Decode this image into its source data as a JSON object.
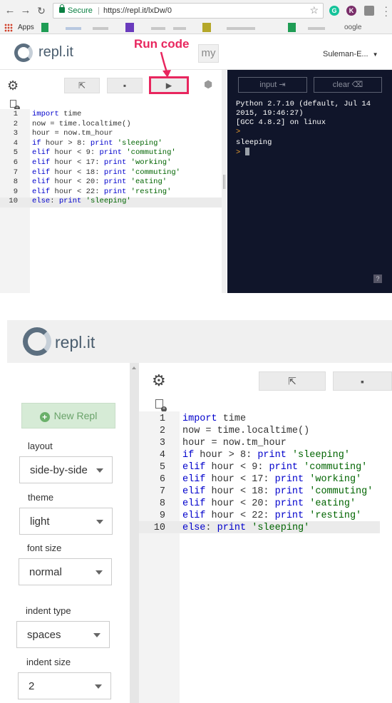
{
  "browser": {
    "secure_label": "Secure",
    "url": "https://repl.it/lxDw/0",
    "apps_label": "Apps",
    "bookmark_text": "oogle",
    "extensions": [
      {
        "icon": "grammarly-icon",
        "letter": "G",
        "color": "#15c39a"
      },
      {
        "icon": "profile-k-icon",
        "letter": "K",
        "color": "#7a2e6a"
      },
      {
        "icon": "screenshot-icon",
        "letter": "",
        "color": "#8a8a8a"
      }
    ]
  },
  "app": {
    "brand": "repl.it",
    "my_label": "my",
    "user_name": "Suleman-E...",
    "annotation": "Run code"
  },
  "editor": {
    "code_lines": [
      "import time",
      "now = time.localtime()",
      "hour = now.tm_hour",
      "if hour > 8: print 'sleeping'",
      "elif hour < 9: print 'commuting'",
      "elif hour < 17: print 'working'",
      "elif hour < 18: print 'commuting'",
      "elif hour < 20: print 'eating'",
      "elif hour < 22: print 'resting'",
      "else: print 'sleeping'"
    ],
    "line_numbers": [
      "1",
      "2",
      "3",
      "4",
      "5",
      "6",
      "7",
      "8",
      "9",
      "10"
    ],
    "active_line": "10"
  },
  "console": {
    "input_label": "input",
    "clear_label": "clear",
    "banner_lines": [
      "Python 2.7.10 (default, Jul 14",
      "2015, 19:46:27)",
      "[GCC 4.8.2] on linux"
    ],
    "prompt_symbol": ">",
    "output": "sleeping",
    "help_label": "?"
  },
  "sidebar": {
    "new_repl_label": "New Repl",
    "settings": [
      {
        "label": "layout",
        "value": "side-by-side"
      },
      {
        "label": "theme",
        "value": "light"
      },
      {
        "label": "font size",
        "value": "normal"
      },
      {
        "label": "indent type",
        "value": "spaces"
      },
      {
        "label": "indent size",
        "value": "2"
      }
    ]
  },
  "colors": {
    "annotation": "#e8265e",
    "console_bg": "#10152a",
    "keyword": "#0000cc",
    "string": "#006400"
  }
}
